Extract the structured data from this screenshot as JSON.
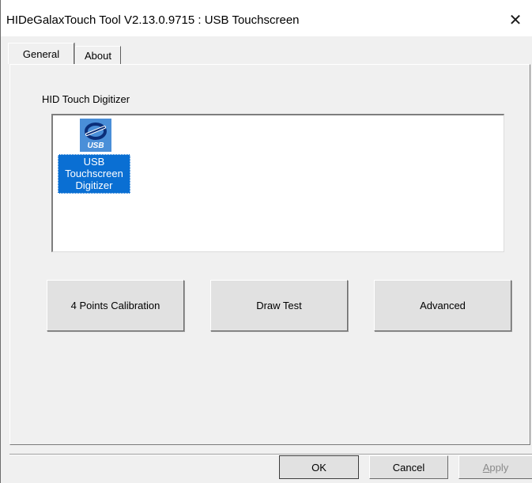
{
  "window": {
    "title": "HIDeGalaxTouch Tool V2.13.0.9715 : USB Touchscreen",
    "close_glyph": "✕"
  },
  "tabs": [
    {
      "label": "General",
      "selected": true
    },
    {
      "label": "About",
      "selected": false
    }
  ],
  "general": {
    "group_label": "HID Touch Digitizer",
    "devices": [
      {
        "icon": "usb-device-icon",
        "icon_text": "USB",
        "label": "USB Touchscreen Digitizer",
        "label_lines": [
          "USB",
          "Touchscreen",
          "Digitizer"
        ],
        "selected": true
      }
    ],
    "buttons": {
      "calibration": "4 Points Calibration",
      "draw_test": "Draw Test",
      "advanced": "Advanced"
    }
  },
  "dialog_buttons": {
    "ok": "OK",
    "cancel": "Cancel",
    "apply_mnemonic": "A",
    "apply_rest": "pply",
    "apply_enabled": false
  },
  "colors": {
    "selection": "#0a6fd3",
    "icon_bg": "#4a8fd8",
    "face": "#f0f0f0"
  }
}
